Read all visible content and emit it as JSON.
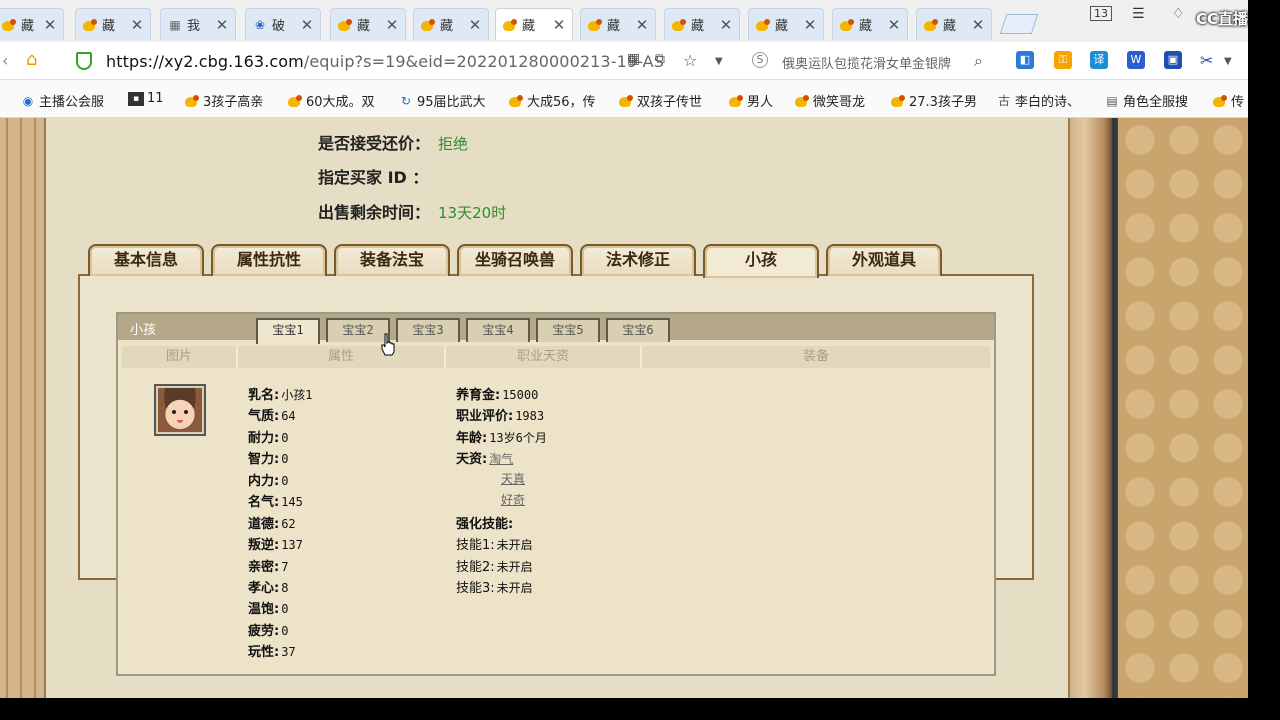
{
  "browser": {
    "tabs": [
      {
        "title": "藏",
        "icon": "duck-icon"
      },
      {
        "title": "藏",
        "icon": "duck-icon"
      },
      {
        "title": "我",
        "icon": "grid-icon"
      },
      {
        "title": "破",
        "icon": "paw-icon"
      },
      {
        "title": "藏",
        "icon": "duck-icon"
      },
      {
        "title": "藏",
        "icon": "duck-icon"
      },
      {
        "title": "藏",
        "icon": "duck-icon",
        "active": true
      },
      {
        "title": "藏",
        "icon": "duck-icon"
      },
      {
        "title": "藏",
        "icon": "duck-icon"
      },
      {
        "title": "藏",
        "icon": "duck-icon"
      },
      {
        "title": "藏",
        "icon": "duck-icon"
      },
      {
        "title": "藏",
        "icon": "duck-icon"
      }
    ],
    "close_glyph": "✕",
    "tab_count": "13",
    "overlay_logo": "CC直播",
    "url_host": "https://xy2.cbg.163.com",
    "url_rest": "/equip?s=19&eid=202201280000213-19-AS",
    "search_placeholder": "俄奥运队包揽花滑女单金银牌",
    "bookmarks": [
      "主播公会服",
      "11",
      "3孩子高亲",
      "60大成。双",
      "95届比武大",
      "大成56，传",
      "双孩子传世",
      "男人",
      "微笑哥龙",
      "27.3孩子男",
      "李白的诗、",
      "角色全服搜",
      "传"
    ]
  },
  "trade": {
    "counter_offer_label": "是否接受还价：",
    "counter_offer_value": "拒绝",
    "buyer_id_label": "指定买家 ID ：",
    "buyer_id_value": "",
    "time_left_label": "出售剩余时间：",
    "time_left_value": "13天20时"
  },
  "section_tabs": [
    "基本信息",
    "属性抗性",
    "装备法宝",
    "坐骑召唤兽",
    "法术修正",
    "小孩",
    "外观道具"
  ],
  "child": {
    "panel_title": "小孩",
    "baby_tabs": [
      "宝宝1",
      "宝宝2",
      "宝宝3",
      "宝宝4",
      "宝宝5",
      "宝宝6"
    ],
    "columns": [
      "图片",
      "属性",
      "职业天资",
      "装备"
    ],
    "attributes": [
      {
        "label": "乳名:",
        "value": "小孩1"
      },
      {
        "label": "气质:",
        "value": "64"
      },
      {
        "label": "耐力:",
        "value": "0"
      },
      {
        "label": "智力:",
        "value": "0"
      },
      {
        "label": "内力:",
        "value": "0"
      },
      {
        "label": "名气:",
        "value": "145"
      },
      {
        "label": "道德:",
        "value": "62"
      },
      {
        "label": "叛逆:",
        "value": "137"
      },
      {
        "label": "亲密:",
        "value": "7"
      },
      {
        "label": "孝心:",
        "value": "8"
      },
      {
        "label": "温饱:",
        "value": "0"
      },
      {
        "label": "疲劳:",
        "value": "0"
      },
      {
        "label": "玩性:",
        "value": "37"
      }
    ],
    "career": {
      "rearing_label": "养育金:",
      "rearing_value": "15000",
      "rating_label": "职业评价:",
      "rating_value": "1983",
      "age_label": "年龄:",
      "age_value": "13岁6个月",
      "talent_label": "天资:",
      "talents": [
        "淘气",
        "天真",
        "好奇"
      ],
      "skills_label": "强化技能:",
      "skills": [
        {
          "label": "技能1:",
          "value": "未开启"
        },
        {
          "label": "技能2:",
          "value": "未开启"
        },
        {
          "label": "技能3:",
          "value": "未开启"
        }
      ]
    }
  }
}
